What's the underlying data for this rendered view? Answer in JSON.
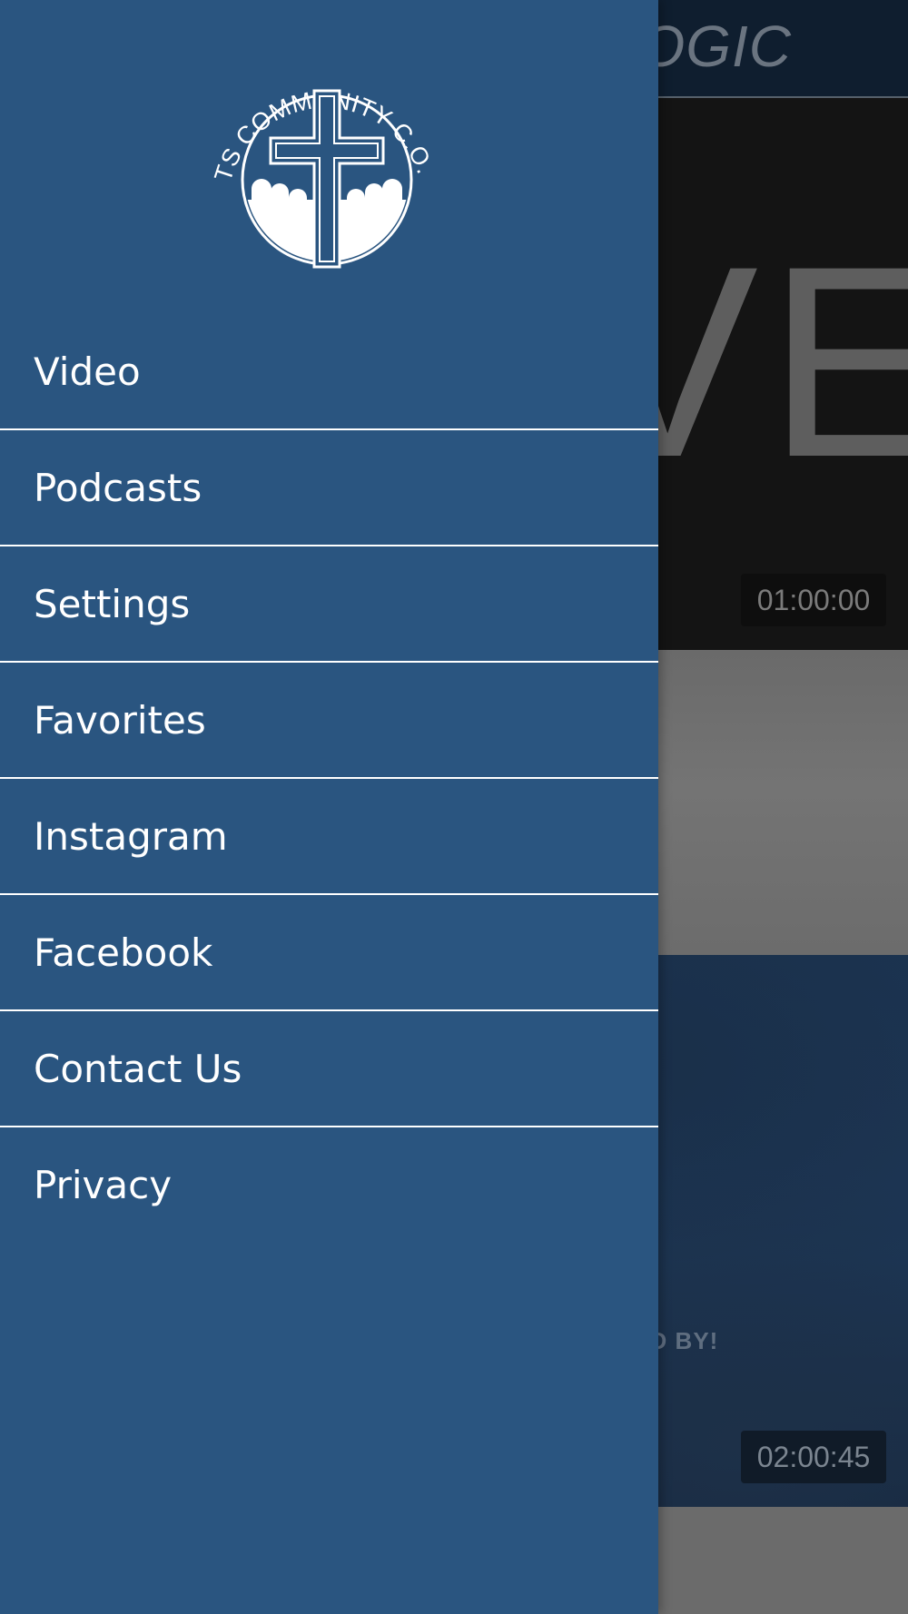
{
  "background": {
    "header_title": "OGIC",
    "card1": {
      "overlay_text": "VE",
      "duration": "01:00:00"
    },
    "card2": {
      "caption": "AND BY!",
      "duration": "02:00:45"
    }
  },
  "drawer": {
    "logo": {
      "arc_text": "SAINTS COMMUNITY C.O.G.I.C.",
      "icon": "church-cross-congregation-logo"
    },
    "menu": [
      {
        "label": "Video"
      },
      {
        "label": "Podcasts"
      },
      {
        "label": "Settings"
      },
      {
        "label": "Favorites"
      },
      {
        "label": "Instagram"
      },
      {
        "label": "Facebook"
      },
      {
        "label": "Contact Us"
      },
      {
        "label": "Privacy"
      }
    ]
  },
  "colors": {
    "drawer_bg": "#2a5580",
    "divider": "#ffffff",
    "header_bg": "#0f1e2f"
  }
}
